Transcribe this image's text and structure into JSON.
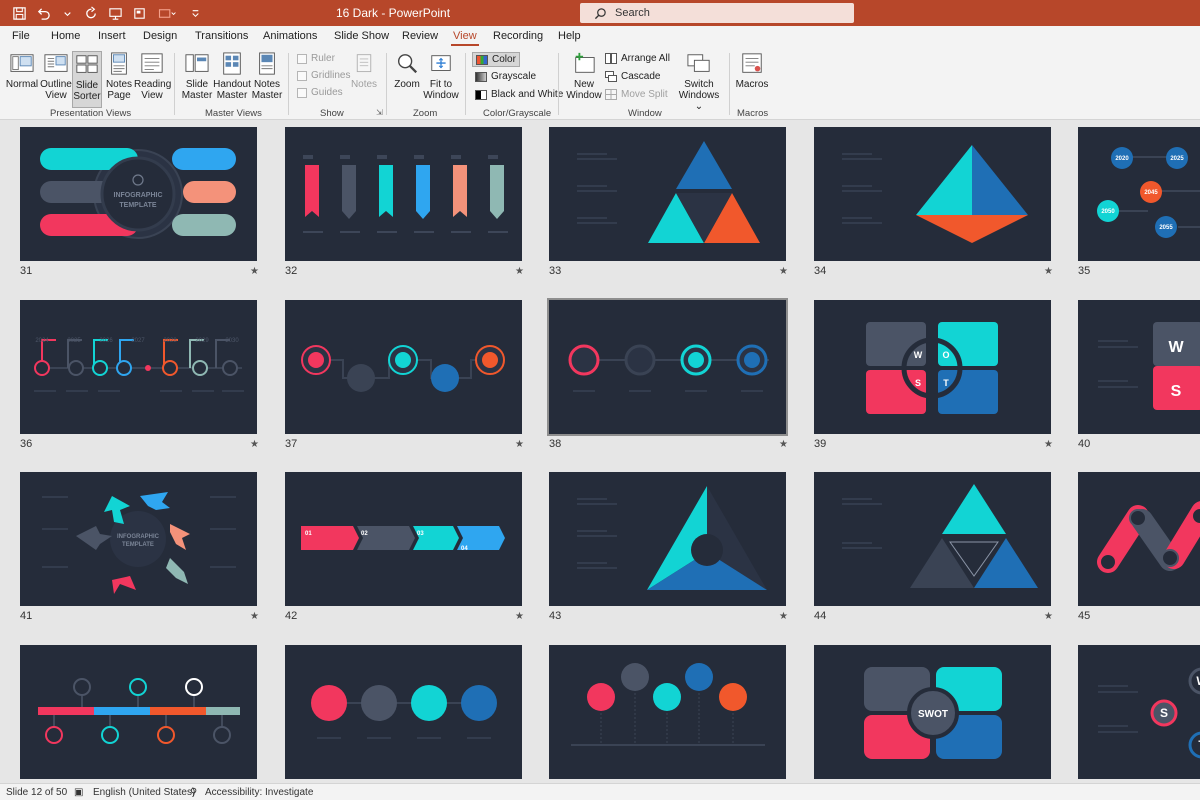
{
  "window": {
    "title": "16 Dark  -  PowerPoint"
  },
  "search": {
    "label": "Search"
  },
  "tabs": [
    "File",
    "Home",
    "Insert",
    "Design",
    "Transitions",
    "Animations",
    "Slide Show",
    "Review",
    "View",
    "Recording",
    "Help"
  ],
  "active_tab": "View",
  "ribbon": {
    "presentation_views": {
      "label": "Presentation Views",
      "buttons": [
        {
          "line1": "Normal",
          "line2": ""
        },
        {
          "line1": "Outline",
          "line2": "View"
        },
        {
          "line1": "Slide",
          "line2": "Sorter"
        },
        {
          "line1": "Notes",
          "line2": "Page"
        },
        {
          "line1": "Reading",
          "line2": "View"
        }
      ]
    },
    "master_views": {
      "label": "Master Views",
      "buttons": [
        {
          "line1": "Slide",
          "line2": "Master"
        },
        {
          "line1": "Handout",
          "line2": "Master"
        },
        {
          "line1": "Notes",
          "line2": "Master"
        }
      ]
    },
    "show": {
      "label": "Show",
      "checks": [
        "Ruler",
        "Gridlines",
        "Guides"
      ],
      "notes": "Notes"
    },
    "zoom": {
      "label": "Zoom",
      "buttons": [
        {
          "line1": "Zoom",
          "line2": ""
        },
        {
          "line1": "Fit to",
          "line2": "Window"
        }
      ]
    },
    "color": {
      "label": "Color/Grayscale",
      "items": [
        "Color",
        "Grayscale",
        "Black and White"
      ]
    },
    "window": {
      "label": "Window",
      "new_window": {
        "line1": "New",
        "line2": "Window"
      },
      "items": [
        "Arrange All",
        "Cascade",
        "Move Split"
      ],
      "switch": {
        "line1": "Switch",
        "line2": "Windows ⌄"
      }
    },
    "macros": {
      "label": "Macros",
      "button": "Macros"
    }
  },
  "slides": [
    {
      "num": "31"
    },
    {
      "num": "32"
    },
    {
      "num": "33"
    },
    {
      "num": "34"
    },
    {
      "num": "35"
    },
    {
      "num": "36"
    },
    {
      "num": "37"
    },
    {
      "num": "38"
    },
    {
      "num": "39"
    },
    {
      "num": "40"
    },
    {
      "num": "41"
    },
    {
      "num": "42"
    },
    {
      "num": "43"
    },
    {
      "num": "44"
    },
    {
      "num": "45"
    },
    {
      "num": ""
    },
    {
      "num": ""
    },
    {
      "num": ""
    },
    {
      "num": ""
    },
    {
      "num": ""
    }
  ],
  "slide_text": {
    "infographic": "INFOGRAPHIC",
    "template": "TEMPLATE",
    "years_36": [
      "2024",
      "2025",
      "2026",
      "2027",
      "2028",
      "2029",
      "2030"
    ],
    "years_35": [
      "2020",
      "2025",
      "2045",
      "2050",
      "2055"
    ],
    "steps_42": [
      "01",
      "02",
      "03",
      "04"
    ],
    "swot": "SWOT",
    "swot_letters": [
      "W",
      "O",
      "S",
      "T"
    ]
  },
  "colors": {
    "pink": "#f2375e",
    "cyan": "#12d4d4",
    "blue": "#1f6fb5",
    "orange": "#f1582c",
    "gray": "#4b5466",
    "salmon": "#f4927a",
    "teal": "#8fb8b3",
    "light_blue": "#2fa6f0",
    "slide_bg": "#252c3a"
  },
  "status": {
    "slide": "Slide 12 of 50",
    "language": "English (United States)",
    "accessibility": "Accessibility: Investigate"
  }
}
